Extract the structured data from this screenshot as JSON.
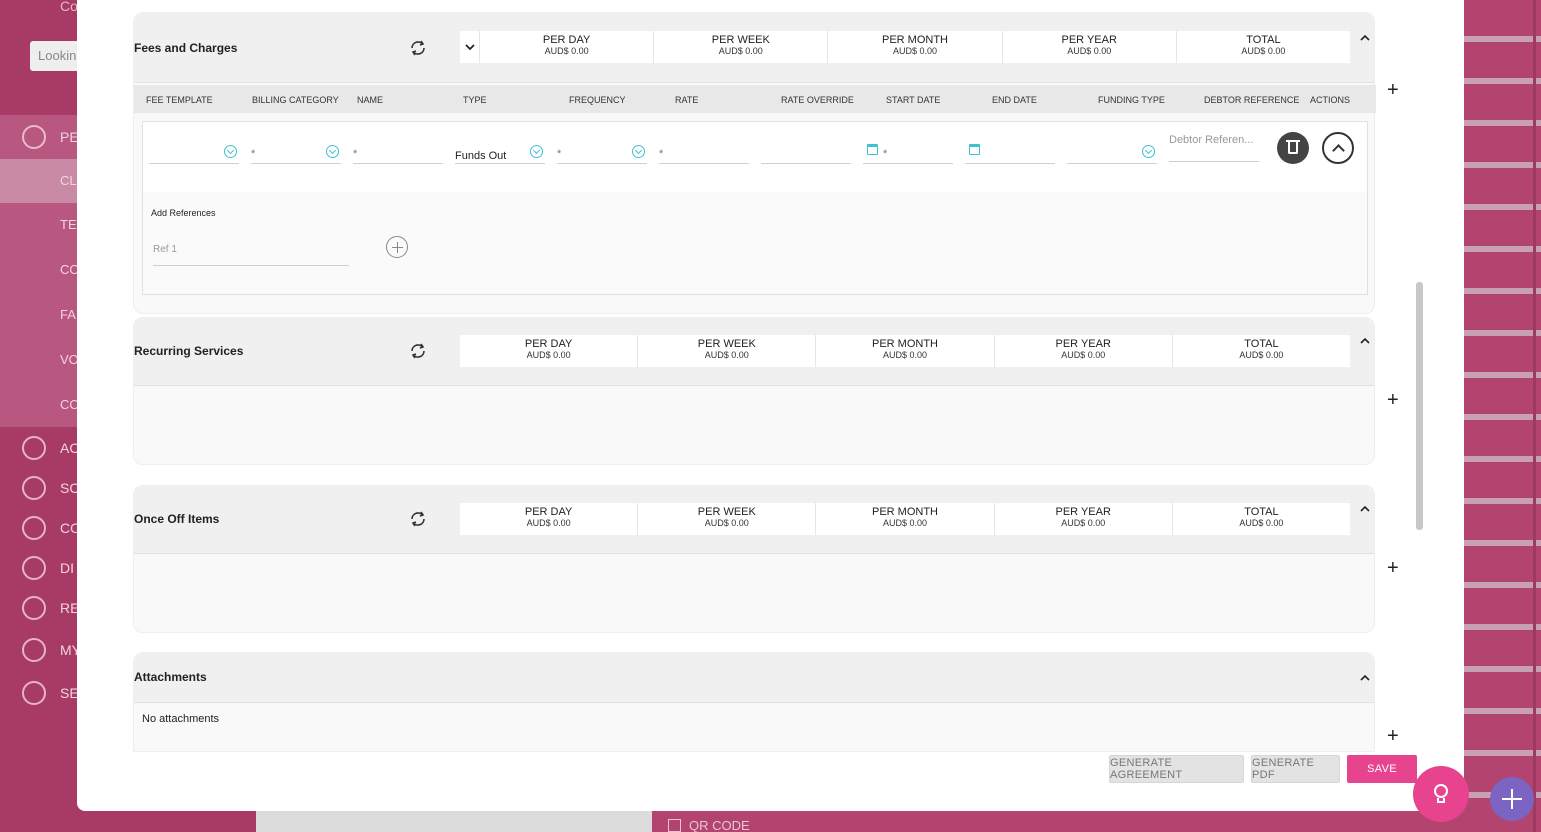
{
  "background": {
    "search_placeholder": "Lookin",
    "header_fragment": "Co",
    "nav_items": [
      "PE",
      "AC",
      "SC",
      "CO",
      "DI",
      "RE",
      "MY",
      "SE"
    ],
    "sub_items": [
      "CL",
      "TE",
      "CO",
      "FA",
      "VO",
      "CO"
    ],
    "qr_label": "QR CODE",
    "brand_color": "#b3436f"
  },
  "totals_headers": [
    "PER DAY",
    "PER WEEK",
    "PER MONTH",
    "PER YEAR",
    "TOTAL"
  ],
  "sections": {
    "fees": {
      "title": "Fees and Charges",
      "totals": [
        "AUD$ 0.00",
        "AUD$ 0.00",
        "AUD$ 0.00",
        "AUD$ 0.00",
        "AUD$ 0.00"
      ],
      "columns": [
        "FEE TEMPLATE",
        "BILLING CATEGORY",
        "NAME",
        "TYPE",
        "FREQUENCY",
        "RATE",
        "RATE OVERRIDE",
        "START DATE",
        "END DATE",
        "FUNDING TYPE",
        "DEBTOR REFERENCE",
        "ACTIONS"
      ],
      "row": {
        "billing_category": "*",
        "name": "*",
        "type": "Funds Out",
        "frequency": "*",
        "rate": "*",
        "start_date": "*",
        "debtor_ref_placeholder": "Debtor Referen..."
      },
      "add_references_label": "Add References",
      "ref_placeholder": "Ref 1"
    },
    "recurring": {
      "title": "Recurring Services",
      "totals": [
        "AUD$ 0.00",
        "AUD$ 0.00",
        "AUD$ 0.00",
        "AUD$ 0.00",
        "AUD$ 0.00"
      ]
    },
    "onceoff": {
      "title": "Once Off Items",
      "totals": [
        "AUD$ 0.00",
        "AUD$ 0.00",
        "AUD$ 0.00",
        "AUD$ 0.00",
        "AUD$ 0.00"
      ]
    },
    "attachments": {
      "title": "Attachments",
      "empty_text": "No attachments"
    }
  },
  "plus_label": "+",
  "buttons": {
    "generate_agreement": "GENERATE AGREEMENT",
    "generate_pdf": "GENERATE PDF",
    "save": "SAVE"
  },
  "colors": {
    "accent": "#e8438f",
    "teal": "#3cc3cf",
    "fab_purple": "#7b64c2"
  }
}
